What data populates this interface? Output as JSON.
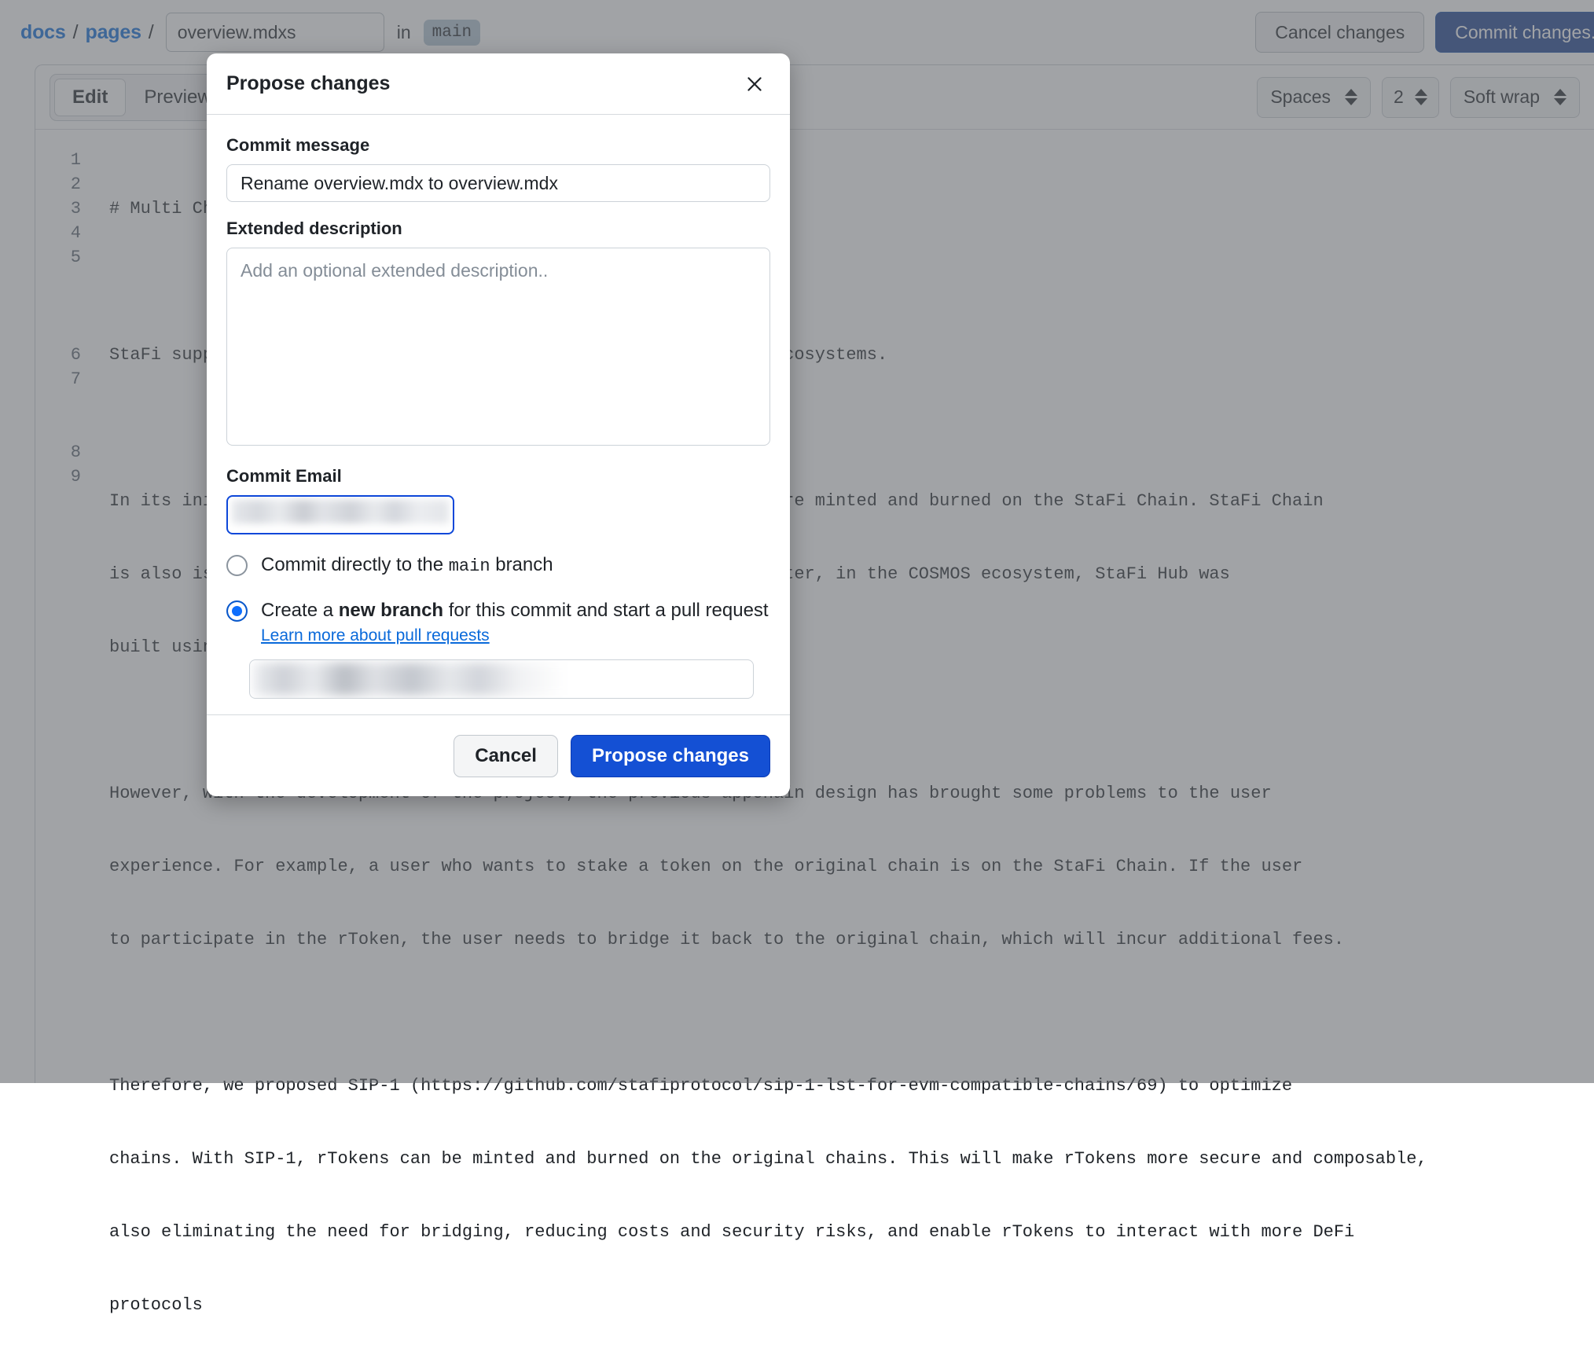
{
  "breadcrumb": {
    "repo_label": "docs",
    "folder_label": "pages",
    "separator": "/",
    "filename_value": "overview.mdxs",
    "in_word": "in",
    "branch_name": "main"
  },
  "header_actions": {
    "cancel_changes_label": "Cancel changes",
    "commit_label": "Commit changes..."
  },
  "editor": {
    "tabs": [
      {
        "label": "Edit",
        "active": true
      },
      {
        "label": "Preview",
        "active": false
      }
    ],
    "indent_mode_label": "Spaces",
    "indent_size_label": "2",
    "third_control_label": "Soft wrap",
    "line_numbers": [
      "1",
      "2",
      "3",
      "4",
      "5",
      "6",
      "7",
      "8",
      "9"
    ],
    "code_lines": [
      "# Multi Chain Support",
      "",
      "StaFi supports rTokens on Ethereum, COSMOS, Polkadot, and other ecosystems.",
      "",
      "In its initial design, StaFi Chain is the appchain that rTokens are minted and burned on the StaFi Chain. StaFi Chain",
      "is also is responsible for the staking and unstaking of assets.Later, in the COSMOS ecosystem, StaFi Hub was",
      "built using the Cosmos SDK.",
      "",
      "However, with the development of the project, the previous appchain design has brought some problems to the user",
      "experience. For example, a user who wants to stake a token on the original chain is on the StaFi Chain. If the user",
      "to participate in the rToken, the user needs to bridge it back to the original chain, which will incur additional fees.",
      "",
      "Therefore, we proposed SIP-1 (https://github.com/stafiprotocol/sip-1-lst-for-evm-compatible-chains/69) to optimize",
      "chains. With SIP-1, rTokens can be minted and burned on the original chains. This will make rTokens more secure and composable,",
      "also eliminating the need for bridging, reducing costs and security risks, and enable rTokens to interact with more DeFi",
      "protocols"
    ]
  },
  "modal": {
    "title": "Propose changes",
    "close_icon": "close-icon",
    "commit_message_label": "Commit message",
    "commit_message_value": "Rename overview.mdx to overview.mdx",
    "extended_description_label": "Extended description",
    "extended_description_value": "",
    "extended_description_placeholder": "Add an optional extended description..",
    "commit_email_label": "Commit Email",
    "commit_email_value": "",
    "commit_email_redacted": true,
    "options": [
      {
        "id": "commit-direct",
        "selected": false,
        "text_before": "Commit directly to the ",
        "mono_text": "main",
        "text_after": " branch"
      },
      {
        "id": "create-branch",
        "selected": true,
        "text_before": "Create a ",
        "bold_text": "new branch",
        "text_after": " for this commit and start a pull request"
      }
    ],
    "learn_more_label": "Learn more about pull requests",
    "new_branch_value": "",
    "new_branch_redacted": true,
    "cancel_label": "Cancel",
    "submit_label": "Propose changes"
  },
  "colors": {
    "link_blue": "#0969da",
    "primary_blue": "#1450d4",
    "focus_blue": "#0d47d9",
    "branch_chip_bg": "#afc3d3",
    "overlay": "rgba(98,102,107,0.60)"
  }
}
